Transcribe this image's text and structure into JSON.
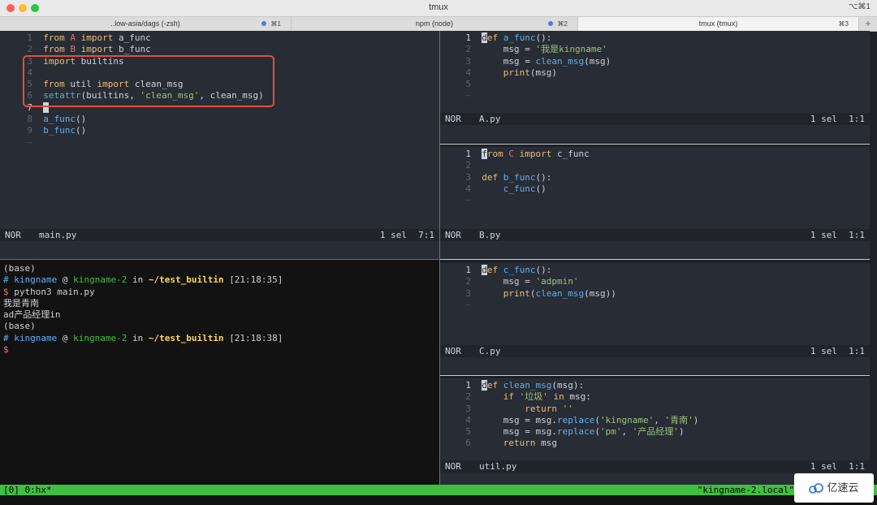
{
  "window": {
    "title": "tmux",
    "shortcut": "⌥⌘1"
  },
  "tabs": [
    {
      "label": "..low-asia/dags (-zsh)",
      "key": "⌘1"
    },
    {
      "label": "npm (node)",
      "key": "⌘2"
    },
    {
      "label": "tmux (tmux)",
      "key": "⌘3"
    }
  ],
  "tab_plus": "+",
  "tilde": "~",
  "editor_main": {
    "status": {
      "mode": "NOR",
      "file": "main.py",
      "sel": "1 sel",
      "pos": "7:1"
    }
  },
  "editor_a": {
    "status": {
      "mode": "NOR",
      "file": "A.py",
      "sel": "1 sel",
      "pos": "1:1"
    }
  },
  "editor_b": {
    "status": {
      "mode": "NOR",
      "file": "B.py",
      "sel": "1 sel",
      "pos": "1:1"
    }
  },
  "editor_c": {
    "status": {
      "mode": "NOR",
      "file": "C.py",
      "sel": "1 sel",
      "pos": "1:1"
    }
  },
  "editor_util": {
    "status": {
      "mode": "NOR",
      "file": "util.py",
      "sel": "1 sel",
      "pos": "1:1"
    }
  },
  "code": {
    "main": {
      "l1": {
        "n": "1",
        "a": "from",
        "b": "A",
        "c": "import",
        "d": "a_func"
      },
      "l2": {
        "n": "2",
        "a": "from",
        "b": "B",
        "c": "import",
        "d": "b_func"
      },
      "l3": {
        "n": "3",
        "a": "import",
        "d": "builtins"
      },
      "l4": {
        "n": "4"
      },
      "l5": {
        "n": "5",
        "a": "from",
        "b": "util",
        "c": "import",
        "d": "clean_msg"
      },
      "l6": {
        "n": "6",
        "f": "setattr",
        "p1": "(builtins, ",
        "s": "'clean_msg'",
        "p2": ", clean_msg)"
      },
      "l7": {
        "n": "7"
      },
      "l8": {
        "n": "8",
        "f": "a_func",
        "p": "()"
      },
      "l9": {
        "n": "9",
        "f": "b_func",
        "p": "()"
      }
    },
    "a": {
      "l1": {
        "n": "1",
        "k": "def",
        "f": "a_func",
        "p": "():"
      },
      "l2": {
        "n": "2",
        "v": "msg",
        "o": " = ",
        "s": "'我是kingname'"
      },
      "l3": {
        "n": "3",
        "v": "msg",
        "o": " = ",
        "f": "clean_msg",
        "p": "(msg)"
      },
      "l4": {
        "n": "4",
        "f": "print",
        "p": "(msg)"
      },
      "l5": {
        "n": "5"
      }
    },
    "b": {
      "l1": {
        "n": "1",
        "k1": "from",
        "m": "C",
        "k2": "import",
        "d": "c_func"
      },
      "l2": {
        "n": "2"
      },
      "l3": {
        "n": "3",
        "k": "def",
        "f": "b_func",
        "p": "():"
      },
      "l4": {
        "n": "4",
        "f": "c_func",
        "p": "()"
      }
    },
    "c": {
      "l1": {
        "n": "1",
        "k": "def",
        "f": "c_func",
        "p": "():"
      },
      "l2": {
        "n": "2",
        "v": "msg",
        "o": " = ",
        "s": "'adpmin'"
      },
      "l3": {
        "n": "3",
        "f": "print",
        "p1": "(",
        "f2": "clean_msg",
        "p2": "(msg))"
      }
    },
    "util": {
      "l1": {
        "n": "1",
        "k": "def",
        "f": "clean_msg",
        "p": "(msg):"
      },
      "l2": {
        "n": "2",
        "k": "if",
        "s": "'垃圾'",
        "k2": "in",
        "p": "msg:"
      },
      "l3": {
        "n": "3",
        "k": "return",
        "s": "''"
      },
      "l4": {
        "n": "4",
        "v": "msg",
        "o": " = msg.",
        "f": "replace",
        "p1": "(",
        "s1": "'kingname'",
        "c": ", ",
        "s2": "'青南'",
        "p2": ")"
      },
      "l5": {
        "n": "5",
        "v": "msg",
        "o": " = msg.",
        "f": "replace",
        "p1": "(",
        "s1": "'pm'",
        "c": ", ",
        "s2": "'产品经理'",
        "p2": ")"
      },
      "l6": {
        "n": "6",
        "k": "return",
        "p": "msg"
      }
    }
  },
  "terminal": {
    "base1": "(base)",
    "prompt1": {
      "hash": "#",
      "user": "kingname",
      "at": "@",
      "host": "kingname-2",
      "in": "in",
      "dir": "~/test_builtin",
      "time": "[21:18:35]"
    },
    "cmd": {
      "dollar": "$",
      "text": "python3 main.py"
    },
    "out1": "我是青南",
    "out2": "ad产品经理in",
    "base2": "(base)",
    "prompt2": {
      "hash": "#",
      "user": "kingname",
      "at": "@",
      "host": "kingname-2",
      "in": "in",
      "dir": "~/test_builtin",
      "time": "[21:18:38]"
    },
    "dollar2": "$"
  },
  "tmux_status": {
    "left": "[0] 0:hx*",
    "right": "\"kingname-2.local\""
  },
  "watermark": {
    "text": "亿速云"
  },
  "colors": {
    "accent_green": "#3fbf3f",
    "highlight_box": "#e0503c",
    "editor_bg": "#282c34"
  }
}
